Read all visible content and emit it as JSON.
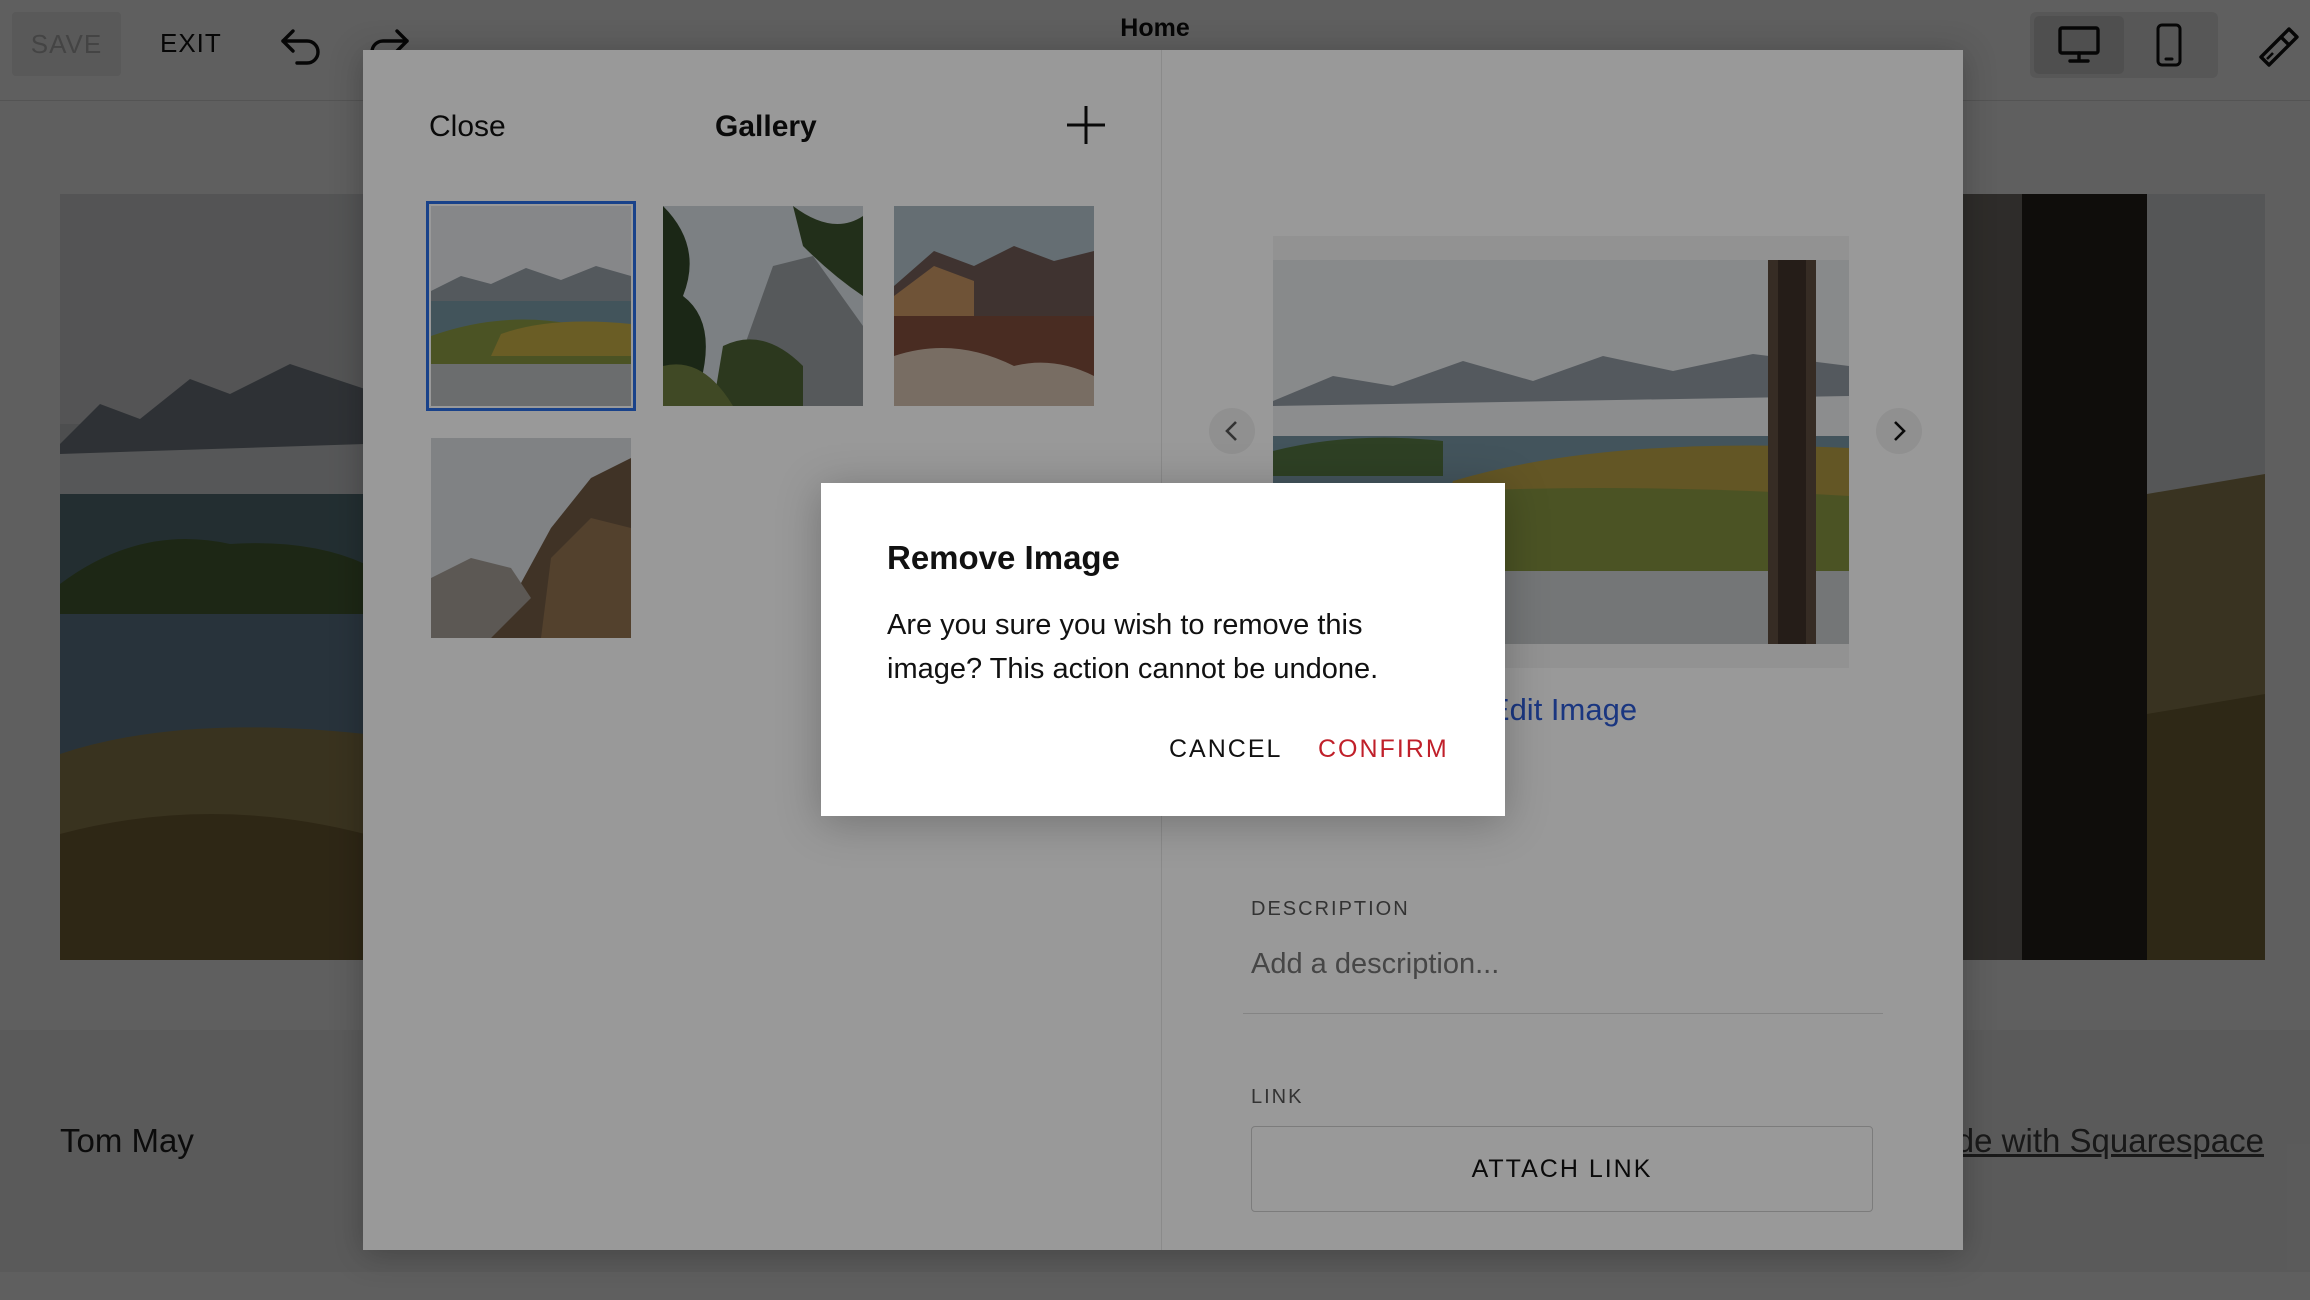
{
  "topbar": {
    "save_label": "SAVE",
    "exit_label": "EXIT",
    "page_title": "Home"
  },
  "footer": {
    "name": "Tom May",
    "made_with": "Made with Squarespace"
  },
  "gallery_panel": {
    "close_label": "Close",
    "title": "Gallery",
    "add_icon": "plus-icon",
    "thumbnails": [
      {
        "subject": "mountain lake landscape",
        "selected": true
      },
      {
        "subject": "trees and mountain",
        "selected": false
      },
      {
        "subject": "mountains at sunset",
        "selected": false
      },
      {
        "subject": "rocky mountainside",
        "selected": false
      }
    ]
  },
  "image_details": {
    "edit_image_label": "Edit Image",
    "description_label": "DESCRIPTION",
    "description_placeholder": "Add a description...",
    "link_label": "LINK",
    "attach_link_label": "ATTACH LINK"
  },
  "dialog": {
    "title": "Remove Image",
    "message": "Are you sure you wish to remove this image? This action cannot be undone.",
    "cancel_label": "CANCEL",
    "confirm_label": "CONFIRM",
    "confirm_color": "#c0202a"
  },
  "colors": {
    "accent_blue": "#2c5bd6",
    "selection_outline": "#2b6ee6"
  }
}
